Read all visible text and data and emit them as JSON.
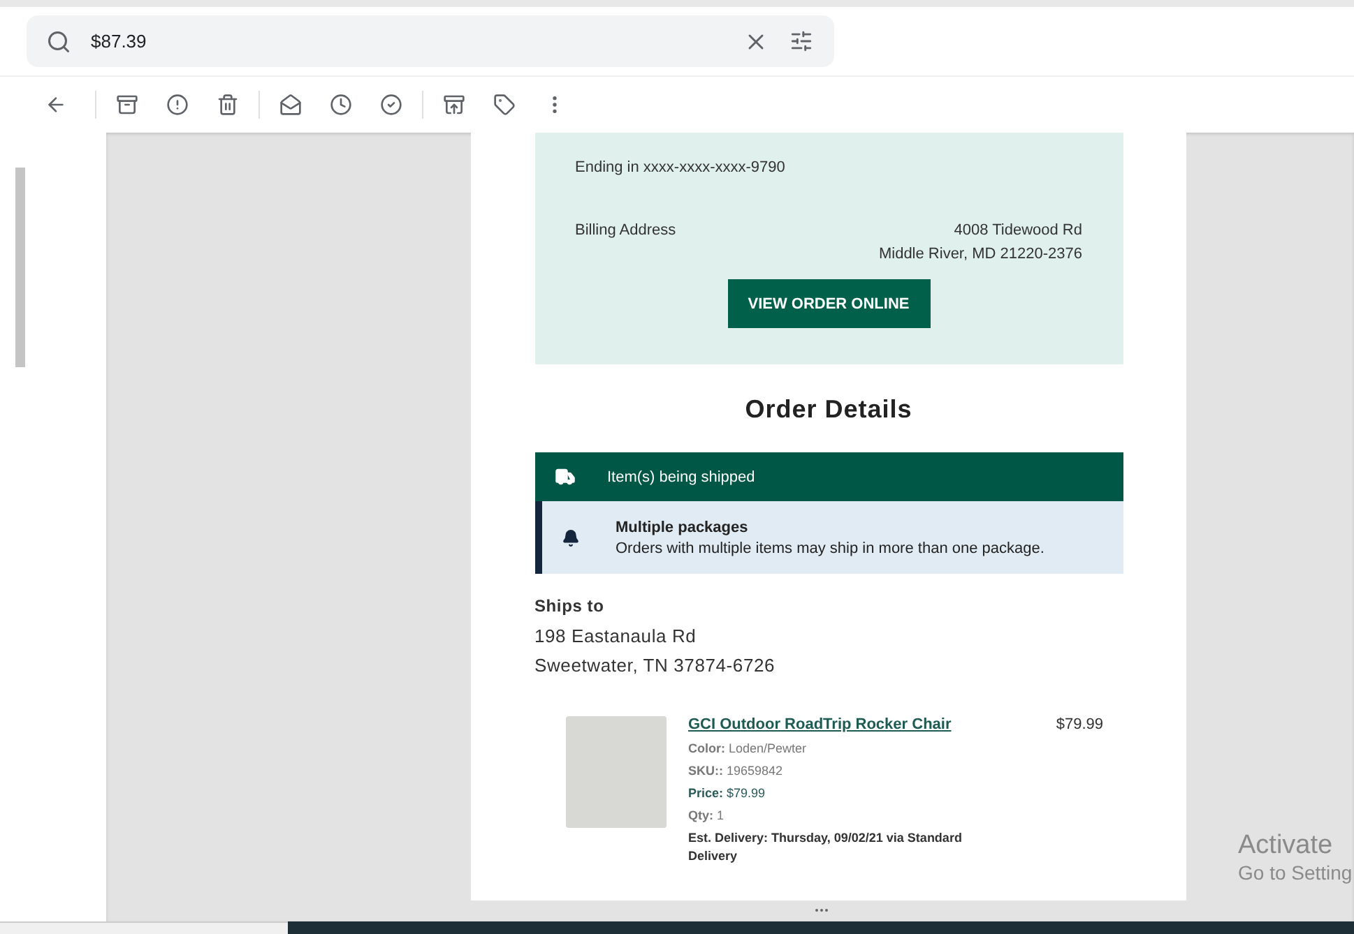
{
  "search": {
    "value": "$87.39"
  },
  "payment": {
    "card_line": "Ending in xxxx-xxxx-xxxx-9790",
    "billing_label": "Billing Address",
    "billing_address": [
      "4008 Tidewood Rd",
      "Middle River, MD 21220-2376"
    ],
    "button": "VIEW ORDER ONLINE"
  },
  "order_details": {
    "title": "Order Details",
    "shipping_banner": {
      "label": "Item(s) being shipped"
    },
    "notice": {
      "title": "Multiple packages",
      "text": "Orders with multiple items may ship in more than one package."
    },
    "ships_to": {
      "label": "Ships to",
      "lines": [
        "198 Eastanaula Rd",
        "Sweetwater, TN 37874-6726"
      ]
    },
    "items": [
      {
        "name": "GCI Outdoor RoadTrip Rocker Chair",
        "price": "$79.99",
        "details": [
          {
            "kind": "muted",
            "label": "Color:",
            "value": "Loden/Pewter"
          },
          {
            "kind": "muted",
            "label": "SKU::",
            "value": "19659842"
          },
          {
            "kind": "accent",
            "label": "Price:",
            "value": "$79.99"
          },
          {
            "kind": "muted",
            "label": "Qty:",
            "value": "1"
          },
          {
            "kind": "strong",
            "label": "Est. Delivery:",
            "value": "Thursday, 09/02/21 via Standard Delivery"
          }
        ]
      }
    ]
  },
  "os_notice": {
    "title": "Activate",
    "subtitle": "Go to Setting"
  }
}
